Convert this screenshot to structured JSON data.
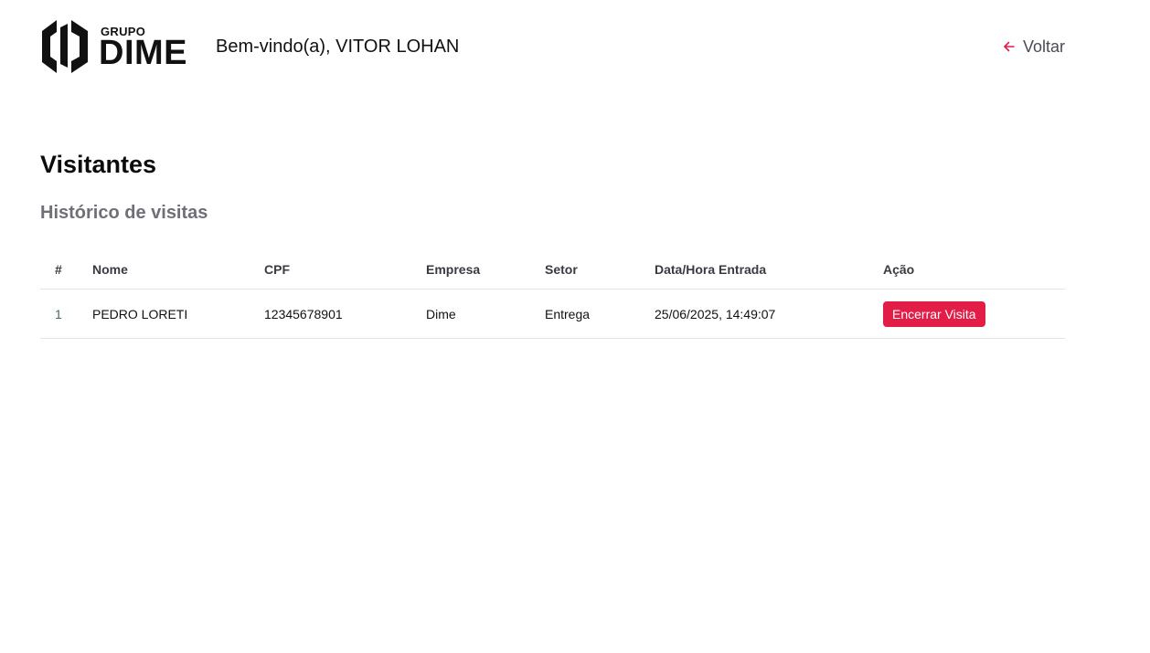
{
  "brand": {
    "logo_small": "GRUPO",
    "logo_large": "DIME"
  },
  "header": {
    "welcome": "Bem-vindo(a), VITOR LOHAN",
    "back_label": "Voltar",
    "back_icon": "arrow-left-icon"
  },
  "page": {
    "title": "Visitantes",
    "section_title": "Histórico de visitas"
  },
  "table": {
    "columns": [
      "#",
      "Nome",
      "CPF",
      "Empresa",
      "Setor",
      "Data/Hora Entrada",
      "Ação"
    ],
    "rows": [
      {
        "index": "1",
        "nome": "PEDRO LORETI",
        "cpf": "12345678901",
        "empresa": "Dime",
        "setor": "Entrega",
        "entrada": "25/06/2025, 14:49:07",
        "action_label": "Encerrar Visita"
      }
    ]
  },
  "colors": {
    "accent": "#e11d48",
    "muted_title": "#6f6f78",
    "border": "#e4e4e7"
  }
}
